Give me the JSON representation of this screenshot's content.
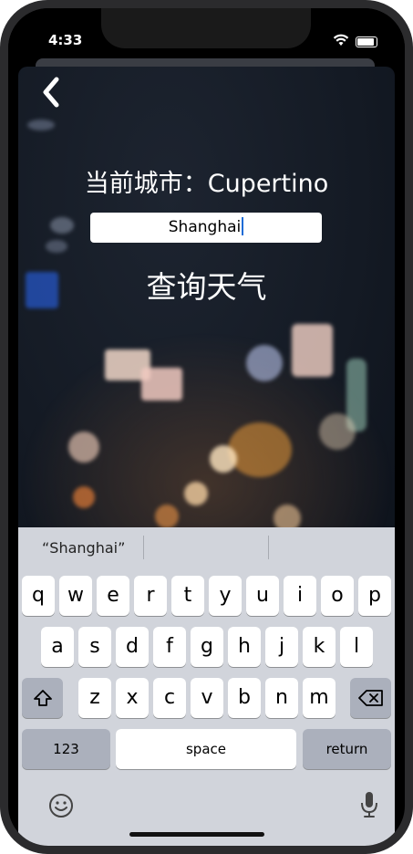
{
  "status_bar": {
    "time": "4:33"
  },
  "app": {
    "city_label": "当前城市：Cupertino",
    "city_input_value": "Shanghai",
    "query_button": "查询天气"
  },
  "keyboard": {
    "suggestion": "“Shanghai”",
    "row1": [
      "q",
      "w",
      "e",
      "r",
      "t",
      "y",
      "u",
      "i",
      "o",
      "p"
    ],
    "row2": [
      "a",
      "s",
      "d",
      "f",
      "g",
      "h",
      "j",
      "k",
      "l"
    ],
    "row3": [
      "z",
      "x",
      "c",
      "v",
      "b",
      "n",
      "m"
    ],
    "numbers_key": "123",
    "space_key": "space",
    "return_key": "return"
  },
  "colors": {
    "background_dark": "#141a24",
    "keyboard_bg": "#d1d4db",
    "cursor": "#1f6cd6"
  }
}
